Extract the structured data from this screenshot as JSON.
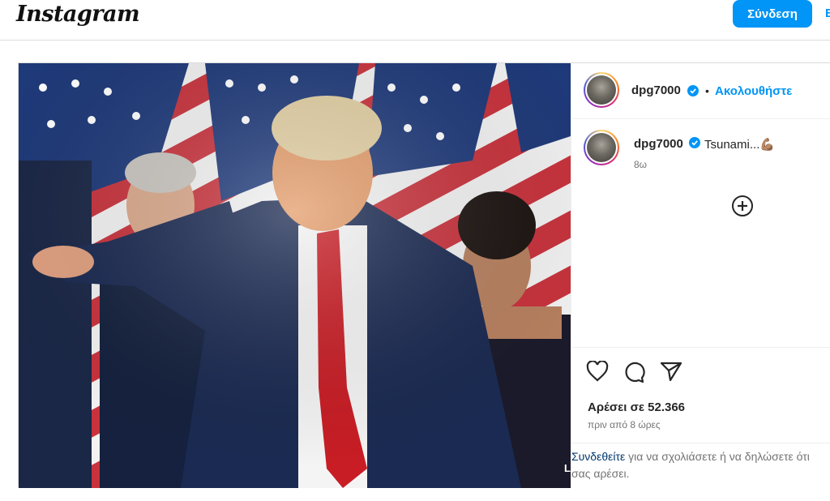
{
  "header": {
    "logo": "Instagram",
    "login_label": "Σύνδεση",
    "signup_label": "E"
  },
  "post": {
    "photo_overlay_text": "L",
    "author": {
      "username": "dpg7000",
      "verified": true,
      "separator": "•",
      "follow_label": "Ακολουθήστε"
    },
    "caption": {
      "username": "dpg7000",
      "text": "Tsunami...💪🏽",
      "time": "8ω"
    },
    "likes": "Αρέσει σε 52.366",
    "posted_ago": "πριν από 8 ώρες",
    "login_prompt": {
      "link": "Συνδεθείτε",
      "rest": " για να σχολιάσετε ή να δηλώσετε ότι σας αρέσει."
    },
    "icons": [
      "heart-icon",
      "comment-icon",
      "share-icon",
      "add-comment-icon",
      "verified-badge-icon"
    ]
  },
  "colors": {
    "accent": "#0095f6",
    "link_dark": "#00376b",
    "verified": "#0095f6"
  }
}
